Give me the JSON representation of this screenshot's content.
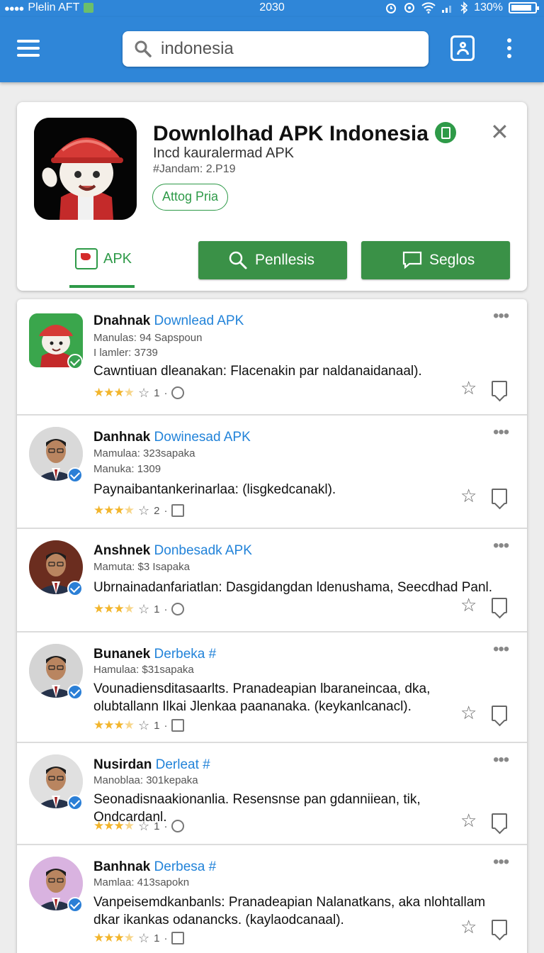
{
  "status_bar": {
    "carrier": "Plelin AFT",
    "time": "2030",
    "battery": "130%"
  },
  "search": {
    "value": "indonesia"
  },
  "app": {
    "title": "Downlolhad APK Indonesia",
    "subtitle": "Incd kauralermad APK",
    "meta": "#Jandam: 2.P19",
    "chip": "Attog Pria",
    "tab_label": "APK",
    "search_button": "Penllesis",
    "chat_button": "Seglos"
  },
  "list": [
    {
      "name": "Dnahnak",
      "link": "Downlead APK",
      "meta1": "Manulas: 94 Sapspoun",
      "meta2": "I lamler: 3739",
      "desc": "Cawntiuan dleanakan: Flacenakin par naldanaidanaal).",
      "count": "1",
      "stat_icon": "at-icon",
      "avatar": "app-mascot",
      "action": "bookmark"
    },
    {
      "name": "Danhnak",
      "link": "Dowinesad APK",
      "meta1": "Mamulaa: 323sapaka",
      "meta2": "Manuka: 1309",
      "desc": "Paynaibantankerinarlaa: (lisgkedcanakl).",
      "count": "2",
      "stat_icon": "image-icon",
      "avatar": "person",
      "action": "bookmark"
    },
    {
      "name": "Anshnek",
      "link": "Donbesadk APK",
      "meta1": "Mamuta: $3 Isapaka",
      "meta2": "",
      "desc": "Ubrnainadanfariatlan: Dasgidangdan ldenushama, Seecdhad Panl.",
      "count": "1",
      "stat_icon": "at-icon",
      "avatar": "person",
      "action": "bookmark"
    },
    {
      "name": "Bunanek",
      "link": "Derbeka #",
      "meta1": "Hamulaa: $31sapaka",
      "meta2": "",
      "desc": "Vounadiensditasaarlts. Pranadeapian lbaraneincaa, dka, olubtallann Ilkai Jlenkaa paananaka. (keykanlcanacl).",
      "count": "1",
      "stat_icon": "image-icon",
      "avatar": "person",
      "action": "bookmark"
    },
    {
      "name": "Nusirdan",
      "link": "Derleat #",
      "meta1": "Manoblaa: 301kepaka",
      "meta2": "",
      "desc": "Seonadisnaakionanlia. Resensnse pan gdanniiean, tik, Ondcardanl.",
      "count": "1",
      "stat_icon": "at-icon",
      "avatar": "person",
      "action": "bookmark"
    },
    {
      "name": "Banhnak",
      "link": "Derbesa #",
      "meta1": "Mamlaa: 413sapokn",
      "meta2": "",
      "desc": "Vanpeisemdkanbanls: Pranadeapian Nalanatkans, aka nlohtallam dkar ikankas odanancks. (kaylaodcanaal).",
      "count": "1",
      "stat_icon": "image-icon",
      "avatar": "person",
      "action": "share"
    }
  ],
  "colors": {
    "primary": "#2f86d8",
    "green": "#3a9147",
    "link": "#2283d9",
    "star": "#f2b52c"
  }
}
